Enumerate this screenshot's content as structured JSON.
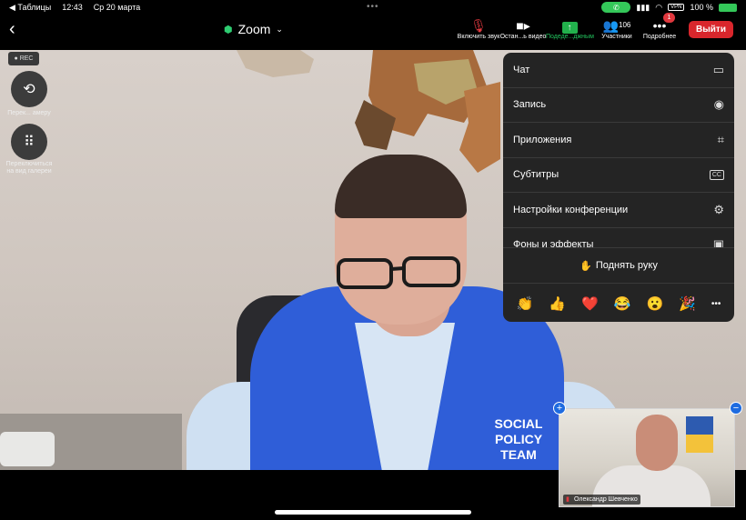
{
  "statusbar": {
    "back_app": "◀ Таблицы",
    "time": "12:43",
    "date": "Ср 20 марта",
    "vpn": "VPN",
    "battery": "100 %"
  },
  "toolbar": {
    "back_icon": "chevron-left",
    "title": "Zoom",
    "unmute_label": "Включить звук",
    "video_label": "Остан...ь видео",
    "share_label": "Подеде...джным",
    "participants_count": "106",
    "participants_label": "Участники",
    "more_label": "Подробнее",
    "more_badge": "1",
    "leave_label": "Выйти"
  },
  "sidebar": {
    "rec": "REC",
    "switch_camera_label": "Перек... амеру",
    "gallery_label": "Переключиться на вид галереи"
  },
  "video": {
    "vest_text": "SOCIAL POLICY TEAM"
  },
  "menu": {
    "items": [
      {
        "label": "Чат",
        "icon": "chat-icon"
      },
      {
        "label": "Запись",
        "icon": "record-icon"
      },
      {
        "label": "Приложения",
        "icon": "apps-icon"
      },
      {
        "label": "Субтитры",
        "icon": "cc-icon"
      },
      {
        "label": "Настройки конференции",
        "icon": "gear-icon"
      },
      {
        "label": "Фоны и эффекты",
        "icon": "background-icon"
      }
    ],
    "raise_hand": "Поднять руку",
    "reactions": [
      "👏",
      "👍",
      "❤️",
      "😂",
      "😮",
      "🎉",
      "•••"
    ]
  },
  "thumbnail": {
    "name": "Олександр Шевченко"
  },
  "colors": {
    "leave": "#d9262c",
    "share": "#22b14c",
    "badge": "#e0383e"
  }
}
